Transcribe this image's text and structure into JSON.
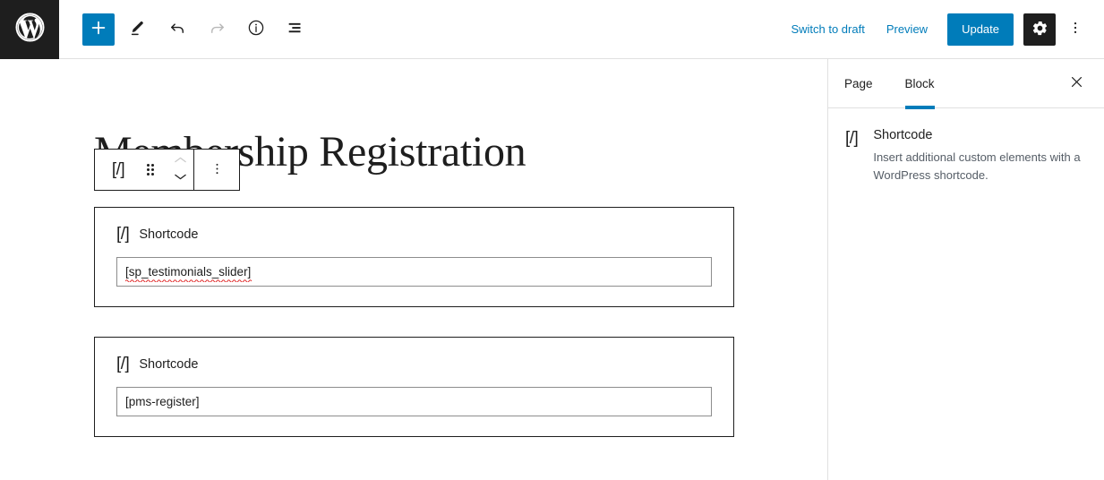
{
  "header": {
    "logo_icon": "wordpress-logo-icon",
    "tools": [
      {
        "name": "block-inserter",
        "icon": "plus-icon",
        "label": "Toggle block inserter",
        "state": "active"
      },
      {
        "name": "tools-pencil",
        "icon": "pencil-icon",
        "label": "Tools",
        "state": "enabled"
      },
      {
        "name": "undo",
        "icon": "undo-arrow-icon",
        "label": "Undo",
        "state": "enabled"
      },
      {
        "name": "redo",
        "icon": "redo-arrow-icon",
        "label": "Redo",
        "state": "disabled"
      },
      {
        "name": "details",
        "icon": "info-circle-icon",
        "label": "Details",
        "state": "enabled"
      },
      {
        "name": "list-view",
        "icon": "list-view-icon",
        "label": "List view",
        "state": "enabled"
      }
    ],
    "switch_to_draft_label": "Switch to draft",
    "preview_label": "Preview",
    "update_label": "Update",
    "settings_icon": "gear-icon",
    "options_icon": "kebab-vertical-icon",
    "accent_color": "#007cba",
    "dark_color": "#1e1e1e"
  },
  "canvas": {
    "post_title": "Membership Registration",
    "block_toolbar": {
      "block_type_icon": "shortcode-icon",
      "block_type_icon_glyph": "[/]",
      "drag_handle_icon": "drag-handle-icon",
      "move_up_icon": "chevron-up-icon",
      "move_down_icon": "chevron-down-icon",
      "options_icon": "kebab-vertical-icon"
    },
    "blocks": [
      {
        "icon_glyph": "[/]",
        "label": "Shortcode",
        "value": "[sp_testimonials_slider]",
        "spellcheck_flag": true
      },
      {
        "icon_glyph": "[/]",
        "label": "Shortcode",
        "value": "[pms-register]",
        "spellcheck_flag": false
      }
    ]
  },
  "sidebar": {
    "tabs": [
      {
        "label": "Page",
        "active": false
      },
      {
        "label": "Block",
        "active": true
      }
    ],
    "close_icon": "close-x-icon",
    "block_card": {
      "icon_glyph": "[/]",
      "title": "Shortcode",
      "description": "Insert additional custom elements with a WordPress shortcode."
    }
  }
}
